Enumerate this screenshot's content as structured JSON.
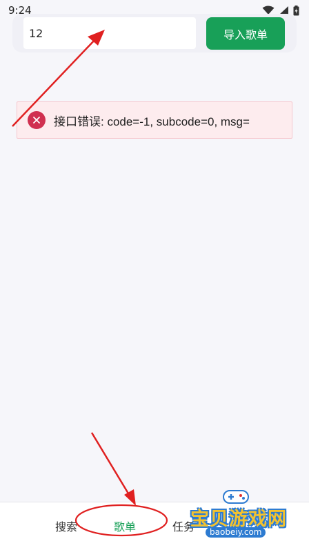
{
  "status_bar": {
    "time": "9:24"
  },
  "import_bar": {
    "input_value": "12",
    "import_button_label": "导入歌单"
  },
  "error_alert": {
    "message": "接口错误: code=-1, subcode=0, msg="
  },
  "tab_bar": {
    "tabs": [
      {
        "label": "搜索"
      },
      {
        "label": "歌单",
        "active": true
      },
      {
        "label": "任务"
      }
    ]
  },
  "watermark": {
    "text": "宝贝游戏网",
    "url": "baobeiy.com"
  },
  "colors": {
    "accent": "#18a058",
    "error": "#d03050",
    "error_bg": "#fdecee",
    "annotation": "#e02020"
  }
}
